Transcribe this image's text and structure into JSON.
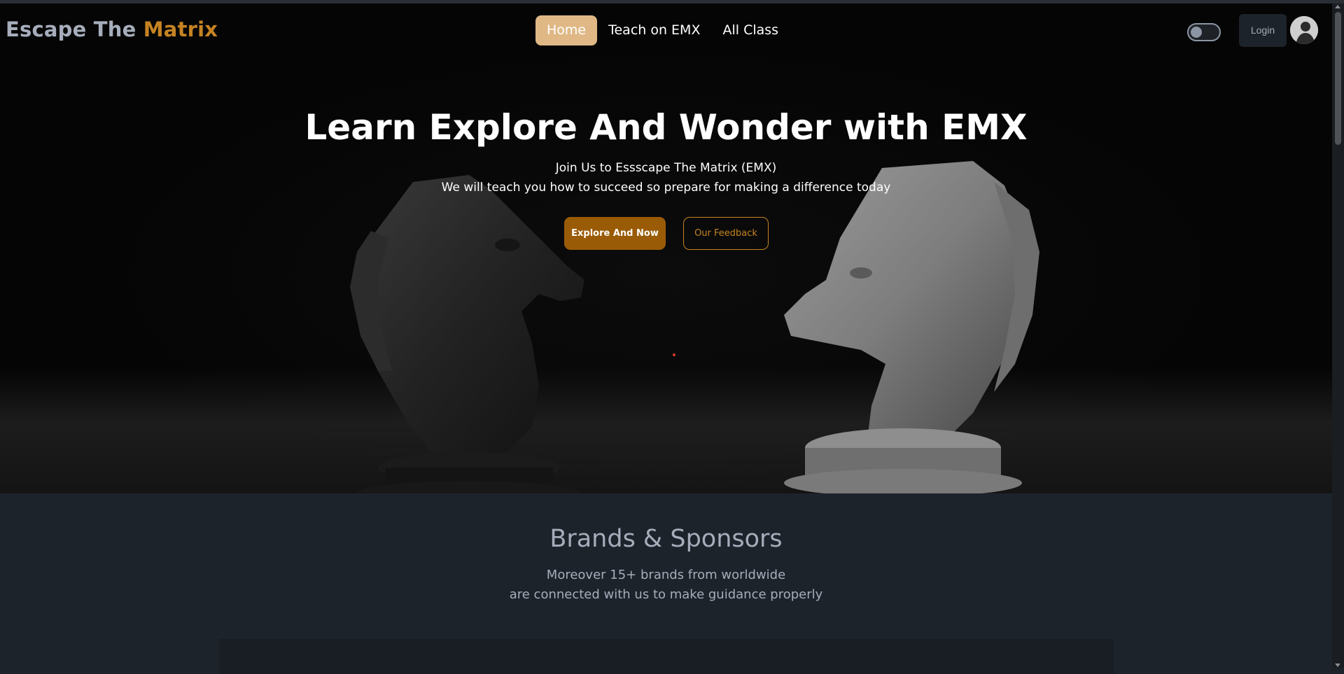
{
  "navbar": {
    "brand_part1": "Escape The",
    "brand_part2": "Matrix",
    "links": [
      {
        "label": "Home",
        "active": true
      },
      {
        "label": "Teach on EMX",
        "active": false
      },
      {
        "label": "All Class",
        "active": false
      }
    ],
    "theme_toggle_on": false,
    "login_label": "Login"
  },
  "hero": {
    "title": "Learn Explore And Wonder with EMX",
    "subtitle_line1": "Join Us to Essscape The Matrix (EMX)",
    "subtitle_line2": "We will teach you how to succeed so prepare for making a difference today",
    "primary_button": "Explore And Now",
    "secondary_button": "Our Feedback"
  },
  "brands": {
    "heading": "Brands & Sponsors",
    "desc_line1": "Moreover 15+ brands from worldwide",
    "desc_line2": "are connected with us to make guidance properly"
  },
  "colors": {
    "accent": "#c58322",
    "primary_button": "#9a5b07",
    "active_nav": "#e0b885",
    "background": "#1d232a"
  }
}
